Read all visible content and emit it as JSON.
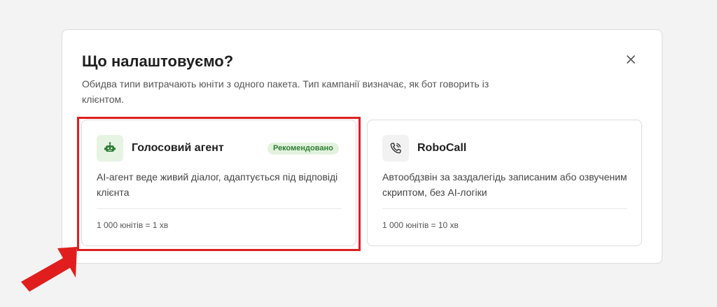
{
  "modal": {
    "title": "Що налаштовуємо?",
    "description": "Обидва типи витрачають юніти з одного пакета. Тип кампанії визначає, як бот говорить із клієнтом.",
    "close_icon": "close-icon"
  },
  "options": [
    {
      "icon": "robot-icon",
      "name": "Голосовий агент",
      "badge": "Рекомендовано",
      "description": "AI-агент веде живий діалог, адаптується під відповіді клієнта",
      "rate": "1 000 юнітів = 1 хв"
    },
    {
      "icon": "phone-call-icon",
      "name": "RoboCall",
      "description": "Автообдзвін за заздалегідь записаним або озвученим скриптом, без AI-логіки",
      "rate": "1 000 юнітів = 10 хв"
    }
  ],
  "colors": {
    "accent_green": "#2e7d32",
    "badge_bg": "#e3f2df",
    "highlight_red": "#e01e1e"
  }
}
